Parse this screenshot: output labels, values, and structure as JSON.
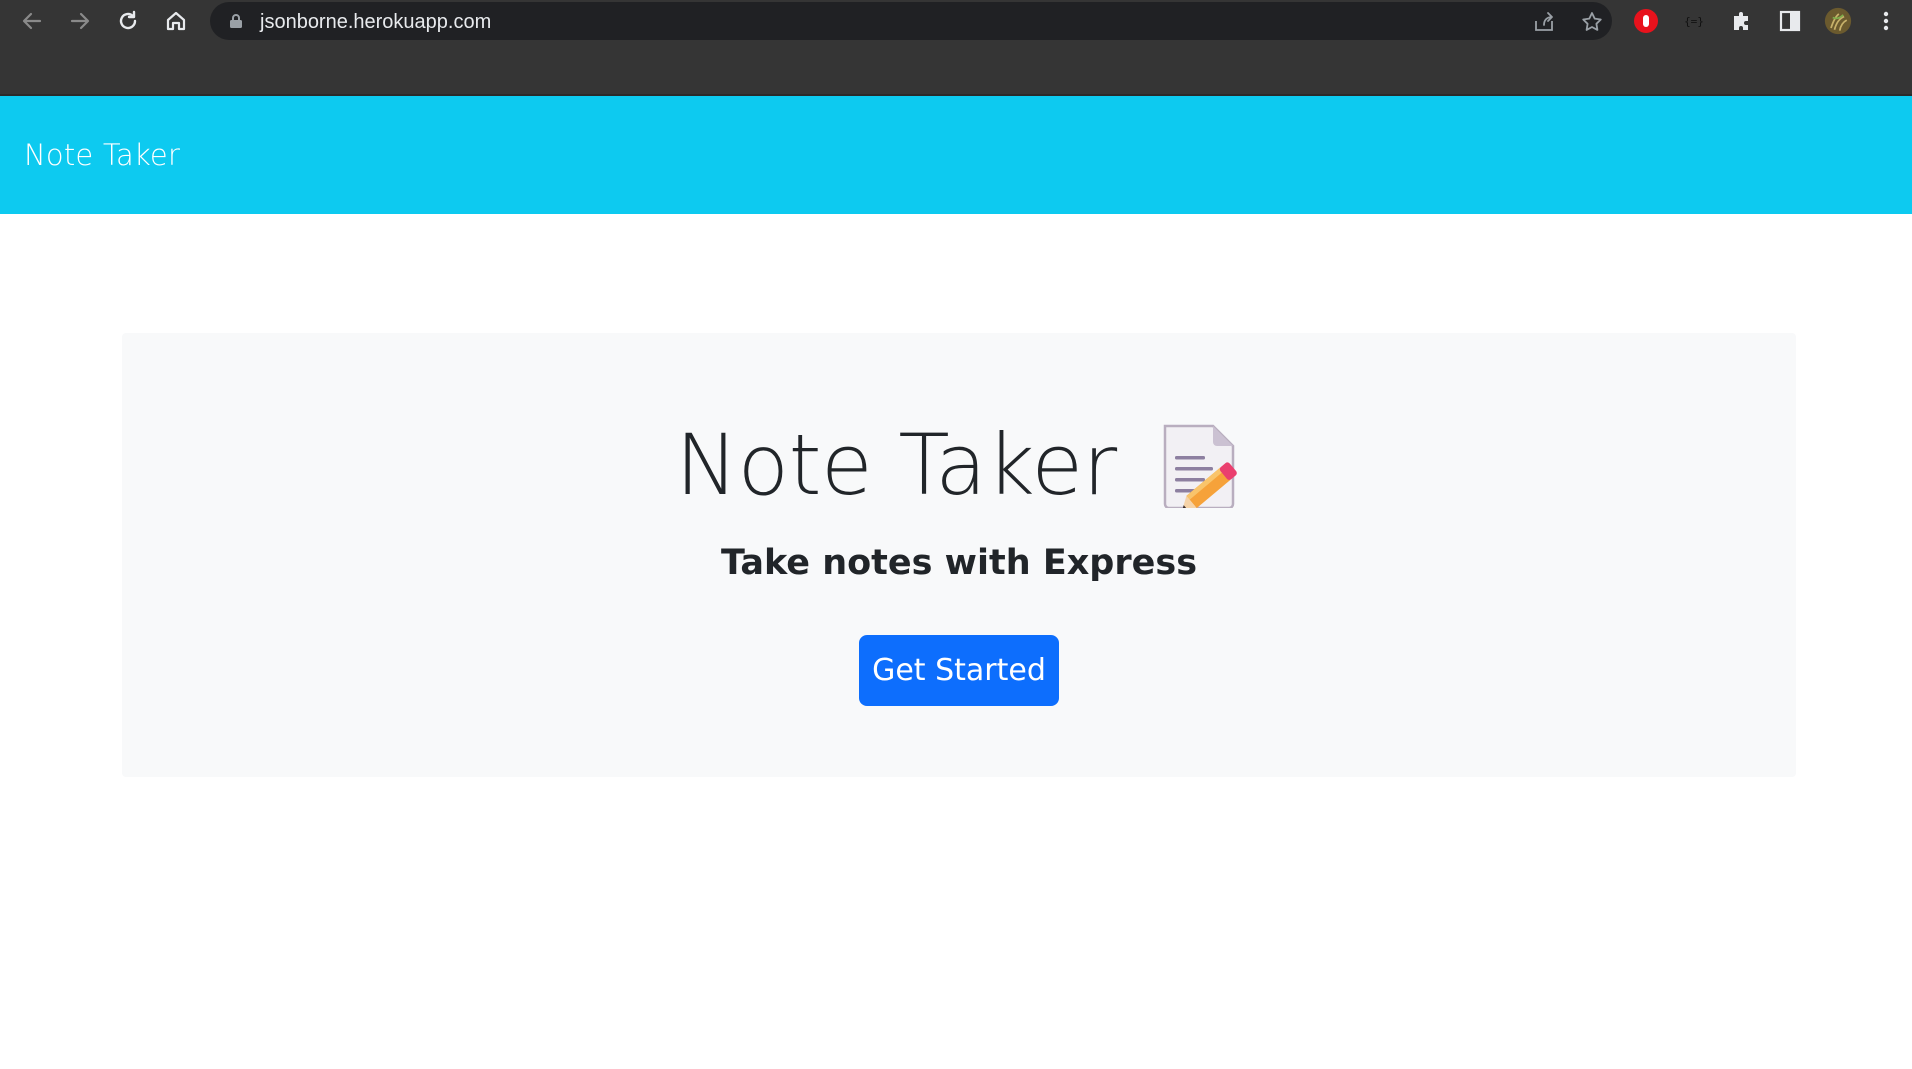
{
  "browser": {
    "url": "jsonborne.herokuapp.com",
    "icons": [
      "back-icon",
      "forward-icon",
      "reload-icon",
      "home-icon",
      "lock-icon",
      "share-icon",
      "star-icon",
      "adblock-icon",
      "json-extension-icon",
      "extensions-icon",
      "side-panel-icon",
      "profile-avatar",
      "menu-icon"
    ]
  },
  "navbar": {
    "brand": "Note Taker",
    "color": "#0dcaf0"
  },
  "hero": {
    "title": "Note Taker",
    "subtitle": "Take notes with Express",
    "icon": "memo-icon",
    "button_label": "Get Started",
    "button_color": "#0d6efd"
  }
}
